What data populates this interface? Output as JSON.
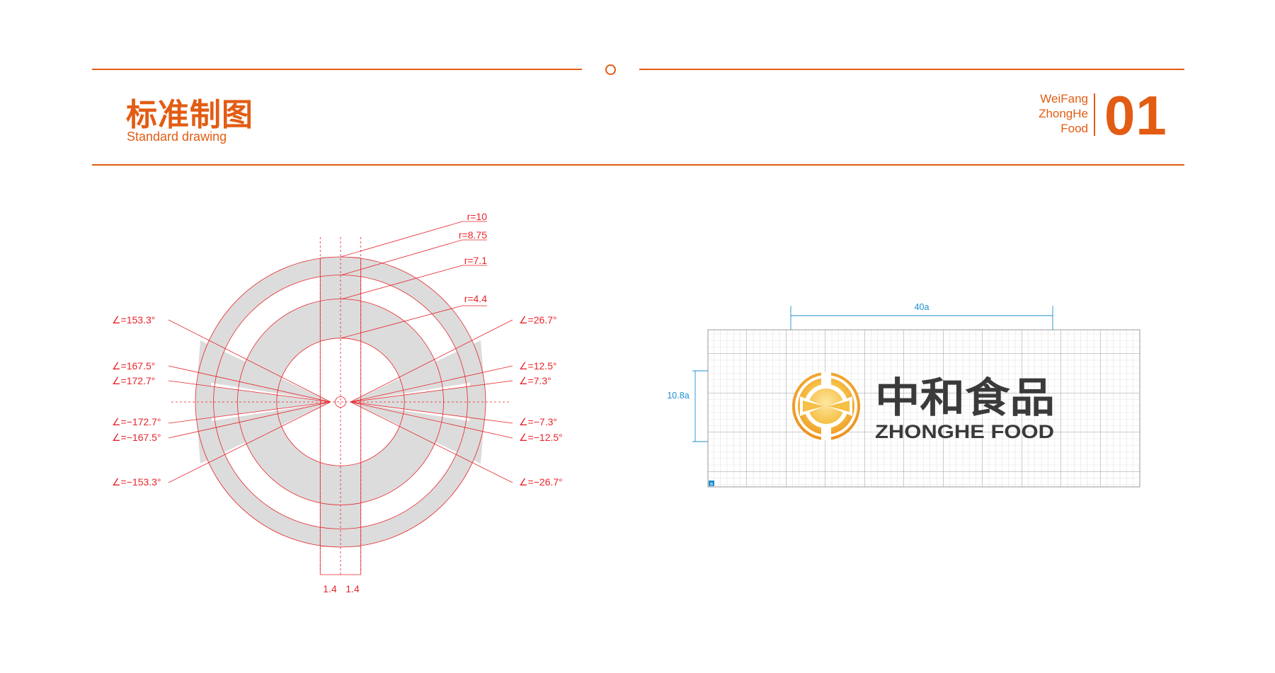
{
  "header": {
    "title_cn": "标准制图",
    "title_en": "Standard drawing",
    "brand_lines": [
      "WeiFang",
      "ZhongHe",
      "Food"
    ],
    "section_number": "01"
  },
  "construction": {
    "radius_labels": [
      "r=10",
      "r=8.75",
      "r=7.1",
      "r=4.4"
    ],
    "angles_left": [
      "∠=153.3°",
      "∠=167.5°",
      "∠=172.7°",
      "∠=−172.7°",
      "∠=−167.5°",
      "∠=−153.3°"
    ],
    "angles_right": [
      "∠=26.7°",
      "∠=12.5°",
      "∠=7.3°",
      "∠=−7.3°",
      "∠=−12.5°",
      "∠=−26.7°"
    ],
    "bar_widths": [
      "1.4",
      "1.4"
    ]
  },
  "grid": {
    "width_label": "40a",
    "height_label": "10.8a",
    "unit_label": "a"
  },
  "logo": {
    "name_cn": "中和食品",
    "name_en": "ZHONGHE FOOD"
  },
  "colors": {
    "accent": "#e25c14",
    "construction_line": "#e8242b",
    "fill_gray": "#dcdcdc",
    "dimension_blue": "#1b8fd0",
    "logo_gold": "#f0a22a",
    "logo_text": "#3a3a3a"
  }
}
